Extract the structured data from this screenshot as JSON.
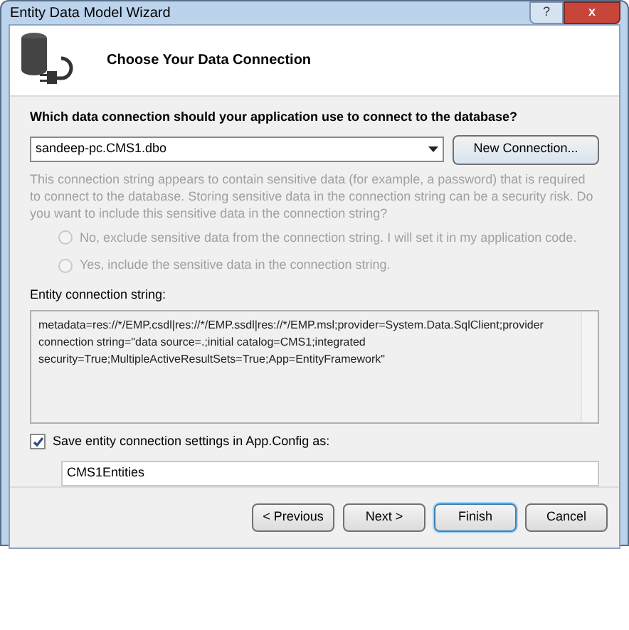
{
  "window": {
    "title": "Entity Data Model Wizard",
    "help_button": "?",
    "close_button": "x"
  },
  "header": {
    "title": "Choose Your Data Connection"
  },
  "question": "Which data connection should your application use to connect to the database?",
  "connection_select": {
    "value": "sandeep-pc.CMS1.dbo"
  },
  "new_connection_button": "New Connection...",
  "sensitive_note": {
    "text": "This connection string appears to contain sensitive data (for example, a password) that is required to connect to the database. Storing sensitive data in the connection string can be a security risk. Do you want to include this sensitive data in the connection string?",
    "disabled": true
  },
  "sensitive_options": [
    {
      "label": "No, exclude sensitive data from the connection string. I will set it in my application code.",
      "selected": false,
      "disabled": true
    },
    {
      "label": "Yes, include the sensitive data in the connection string.",
      "selected": false,
      "disabled": true
    }
  ],
  "entity_connection": {
    "label": "Entity connection string:",
    "value": "metadata=res://*/EMP.csdl|res://*/EMP.ssdl|res://*/EMP.msl;provider=System.Data.SqlClient;provider connection string=\"data source=.;initial catalog=CMS1;integrated security=True;MultipleActiveResultSets=True;App=EntityFramework\""
  },
  "save_settings": {
    "label": "Save entity connection settings in App.Config as:",
    "checked": true,
    "value": "CMS1Entities"
  },
  "buttons": [
    {
      "label": "< Previous",
      "default": false
    },
    {
      "label": "Next >",
      "default": false
    },
    {
      "label": "Finish",
      "default": true
    },
    {
      "label": "Cancel",
      "default": false
    }
  ]
}
